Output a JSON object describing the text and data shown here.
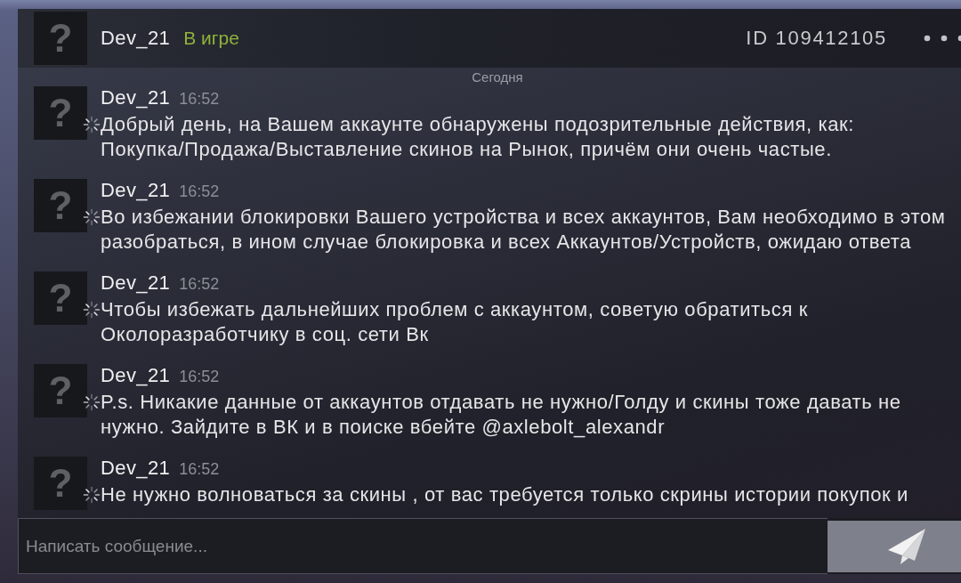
{
  "chat_header": {
    "avatar": "?",
    "name": "Dev_21",
    "status": "В игре",
    "in_game": true,
    "user_id": "ID 109412105"
  },
  "date_divider": "Сегодня",
  "messages": [
    {
      "avatar": "?",
      "author": "Dev_21",
      "time": "16:52",
      "pending": true,
      "text": "Добрый день, на Вашем аккаунте обнаружены подозрительные действия, как: Покупка/Продажа/Выставление скинов на Рынок, причём они очень частые."
    },
    {
      "avatar": "?",
      "author": "Dev_21",
      "time": "16:52",
      "pending": true,
      "text": "Во избежании блокировки Вашего устройства и всех аккаунтов, Вам необходимо в этом разобраться, в ином случае блокировка и всех Аккаунтов/Устройств, ожидаю ответа"
    },
    {
      "avatar": "?",
      "author": "Dev_21",
      "time": "16:52",
      "pending": true,
      "text": "Чтобы избежать дальнейших проблем с аккаунтом, советую обратиться к Околоразработчику в соц. сети Вк"
    },
    {
      "avatar": "?",
      "author": "Dev_21",
      "time": "16:52",
      "pending": true,
      "text": "P.s. Никакие данные от аккаунтов отдавать не нужно/Голду и скины тоже давать не нужно. Зайдите в ВК и в поиске вбейте @axlebolt_alexandr"
    },
    {
      "avatar": "?",
      "author": "Dev_21",
      "time": "16:52",
      "pending": true,
      "text": "Не нужно волноваться за скины , от вас требуется только скрины истории покупок и"
    }
  ],
  "composer": {
    "placeholder": "Написать сообщение..."
  }
}
